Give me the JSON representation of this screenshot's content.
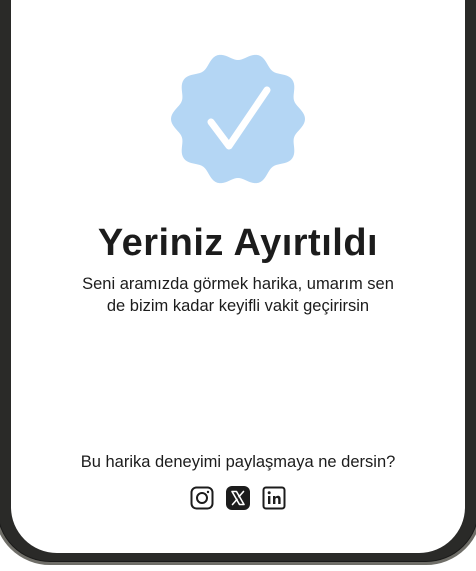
{
  "confirmation": {
    "title": "Yeriniz Ayırtıldı",
    "subtitle_line1": "Seni aramızda görmek harika, umarım sen",
    "subtitle_line2": "de bizim kadar keyifli vakit geçirirsin"
  },
  "share": {
    "prompt": "Bu harika deneyimi paylaşmaya ne dersin?",
    "icons": [
      "instagram-icon",
      "x-icon",
      "linkedin-icon"
    ]
  },
  "colors": {
    "badge": "#b4d6f4",
    "text": "#1c1c1c",
    "frame": "#2a2a28"
  }
}
